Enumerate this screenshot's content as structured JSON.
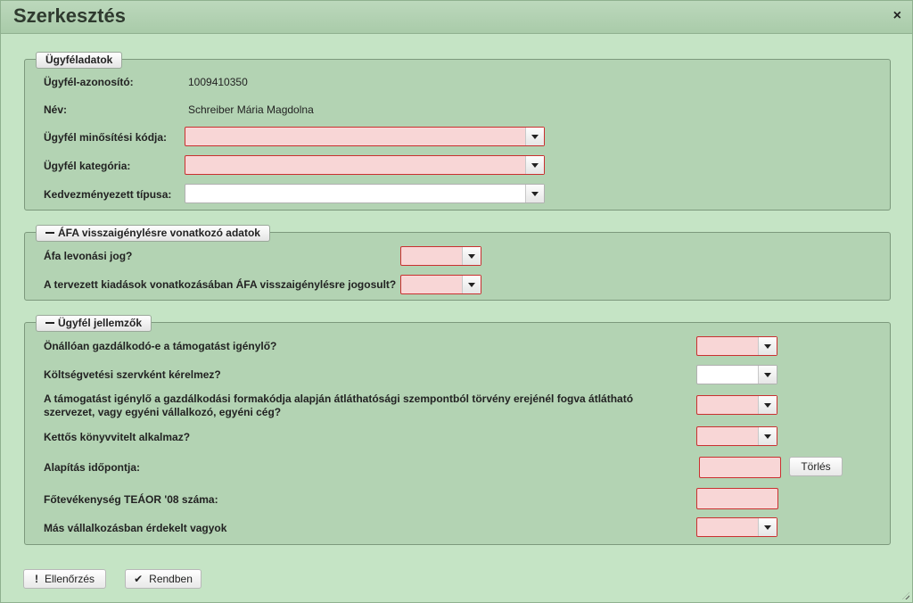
{
  "dialog": {
    "title": "Szerkesztés",
    "close_label": "×"
  },
  "customer": {
    "legend": "Ügyféladatok",
    "id_label": "Ügyfél-azonosító:",
    "id_value": "1009410350",
    "name_label": "Név:",
    "name_value": "Schreiber Mária Magdolna",
    "qualification_label": "Ügyfél minősítési kódja:",
    "category_label": "Ügyfél kategória:",
    "beneficiary_type_label": "Kedvezményezett típusa:"
  },
  "vat": {
    "legend": "ÁFA visszaigénylésre vonatkozó adatok",
    "deduction_label": "Áfa levonási jog?",
    "entitled_label": "A tervezett kiadások vonatkozásában ÁFA visszaigénylésre jogosult?"
  },
  "traits": {
    "legend": "Ügyfél jellemzők",
    "independent_label": "Önállóan gazdálkodó-e a támogatást igénylő?",
    "budget_org_label": "Költségvetési szervként kérelmez?",
    "transparency_label": "A támogatást igénylő a gazdálkodási formakódja alapján átláthatósági szempontból törvény erejénél fogva átlátható szervezet, vagy egyéni vállalkozó, egyéni cég?",
    "double_entry_label": "Kettős könyvvitelt alkalmaz?",
    "founding_date_label": "Alapítás időpontja:",
    "clear_button": "Törlés",
    "teaor_label": "Főtevékenység TEÁOR '08 száma:",
    "other_enterprise_label": "Más vállalkozásban érdekelt vagyok"
  },
  "footer": {
    "check_button": "Ellenőrzés",
    "ok_button": "Rendben"
  },
  "icons": {
    "check_icon": "exclamation-icon",
    "ok_icon": "checkmark-icon",
    "close_icon": "close-icon",
    "collapse_icon": "minus-icon"
  },
  "colors": {
    "background": "#c5e4c5",
    "panel": "#b3d3b3",
    "required_fill": "#f8d6d6",
    "required_border": "#c93030"
  }
}
